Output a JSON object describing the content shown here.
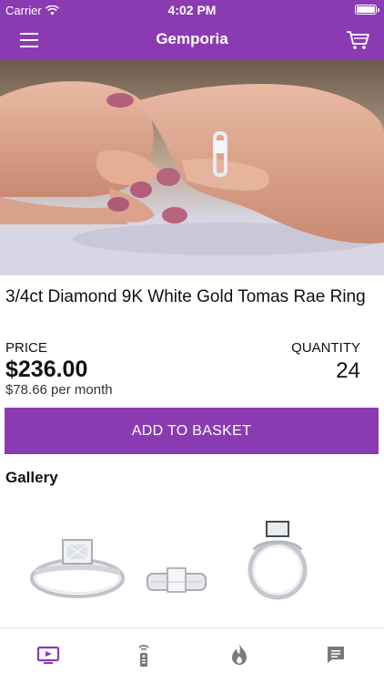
{
  "status_bar": {
    "carrier": "Carrier",
    "time": "4:02 PM"
  },
  "navbar": {
    "title": "Gemporia",
    "menu_icon": "hamburger-menu-icon",
    "cart_icon": "shopping-cart-icon"
  },
  "product": {
    "title": "3/4ct Diamond 9K White Gold Tomas Rae Ring",
    "price_label": "PRICE",
    "price": "$236.00",
    "monthly": "$78.66 per month",
    "quantity_label": "QUANTITY",
    "quantity": "24"
  },
  "add_to_basket_label": "ADD TO BASKET",
  "gallery": {
    "title": "Gallery",
    "images": [
      "ring-front-view-image",
      "ring-flat-view-image",
      "ring-side-view-image"
    ]
  },
  "tabbar": {
    "tabs": [
      "tv-icon",
      "remote-icon",
      "flame-icon",
      "chat-icon"
    ],
    "active_tab": "tv-icon"
  },
  "colors": {
    "brand": "#8a3bb2",
    "inactive_icon": "#7a7a7a",
    "text": "#111111"
  }
}
